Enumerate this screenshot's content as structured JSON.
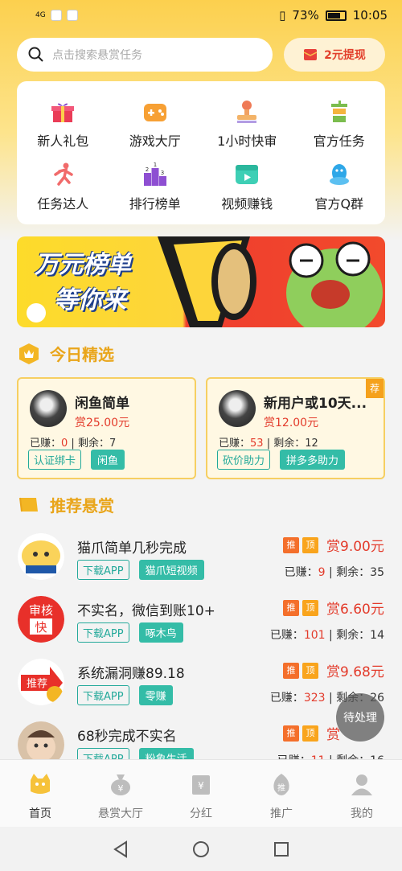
{
  "status": {
    "time": "10:05",
    "battery": "73%",
    "network": "4G"
  },
  "search": {
    "placeholder": "点击搜索悬赏任务"
  },
  "withdraw": {
    "label": "2元提现"
  },
  "grid": [
    {
      "label": "新人礼包",
      "icon": "gift-icon"
    },
    {
      "label": "游戏大厅",
      "icon": "gamepad-icon"
    },
    {
      "label": "1小时快审",
      "icon": "stamp-icon"
    },
    {
      "label": "官方任务",
      "icon": "official-icon"
    },
    {
      "label": "任务达人",
      "icon": "runner-icon"
    },
    {
      "label": "排行榜单",
      "icon": "podium-icon"
    },
    {
      "label": "视频赚钱",
      "icon": "video-icon"
    },
    {
      "label": "官方Q群",
      "icon": "qq-icon"
    }
  ],
  "banner": {
    "line1": "万元榜单",
    "line2": "等你来"
  },
  "today": {
    "title": "今日精选"
  },
  "picks": [
    {
      "name": "闲鱼简单",
      "price": "赏25.00元",
      "earned_label": "已赚：",
      "earned": "0",
      "remain_label": " | 剩余：7",
      "tags": [
        "认证绑卡",
        "闲鱼"
      ]
    },
    {
      "name": "新用户或10天...",
      "price": "赏12.00元",
      "earned_label": "已赚：",
      "earned": "53",
      "remain_label": " | 剩余：12",
      "tags": [
        "砍价助力",
        "拼多多助力"
      ],
      "ribbon": "荐"
    }
  ],
  "recommend": {
    "title": "推荐悬赏"
  },
  "badges": {
    "tui": "推",
    "ding": "顶"
  },
  "tasks": [
    {
      "title": "猫爪简单几秒完成",
      "tags": [
        "下载APP",
        "猫爪短视频"
      ],
      "price": "赏9.00元",
      "earned": "9",
      "remain": "35"
    },
    {
      "title": "不实名，微信到账10+",
      "tags": [
        "下载APP",
        "啄木鸟"
      ],
      "price": "赏6.60元",
      "earned": "101",
      "remain": "14"
    },
    {
      "title": "系统漏洞赚89.18",
      "tags": [
        "下载APP",
        "零赚"
      ],
      "price": "赏9.68元",
      "earned": "323",
      "remain": "26"
    },
    {
      "title": "68秒完成不实名",
      "tags": [
        "下载APP",
        "粉象生活"
      ],
      "price": "赏",
      "earned": "11",
      "remain": "16"
    }
  ],
  "stat_labels": {
    "earned": "已赚：",
    "remain": " | 剩余："
  },
  "float_button": {
    "label": "待处理"
  },
  "tabs": [
    {
      "label": "首页",
      "icon": "home-icon"
    },
    {
      "label": "悬赏大厅",
      "icon": "money-bag-icon"
    },
    {
      "label": "分红",
      "icon": "dividend-icon"
    },
    {
      "label": "推广",
      "icon": "promote-icon"
    },
    {
      "label": "我的",
      "icon": "user-icon"
    }
  ]
}
